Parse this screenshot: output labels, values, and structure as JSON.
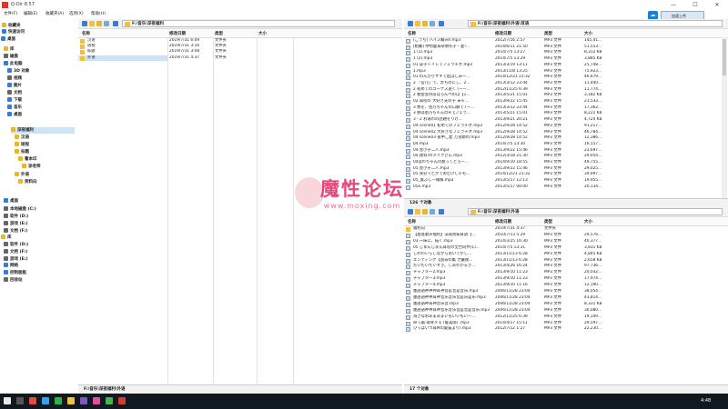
{
  "window": {
    "title": "Q-Dir 8.57",
    "min": "—",
    "max": "☐",
    "close": "✕"
  },
  "menubar": {
    "items": [
      "文件(F)",
      "编辑(E)",
      "收藏夹(A)",
      "选项(X)",
      "帮助(H)"
    ],
    "extra_button": "加速上传"
  },
  "tree": {
    "items": [
      {
        "label": "收藏夹",
        "color": "#e8b730"
      },
      {
        "label": "快速访问",
        "color": "#3a7bd5"
      },
      {
        "label": "桌面",
        "color": "#3a7bd5"
      },
      {
        "label": "库",
        "color": "#e8b730"
      },
      {
        "label": "磁盘",
        "color": "#666666"
      },
      {
        "label": "此电脑",
        "color": "#3a7bd5"
      },
      {
        "label": "3D 对象",
        "color": "#3a7bd5"
      },
      {
        "label": "视频",
        "color": "#666666"
      },
      {
        "label": "图片",
        "color": "#3a7bd5"
      },
      {
        "label": "文档",
        "color": "#666666"
      },
      {
        "label": "下载",
        "color": "#3a7bd5"
      },
      {
        "label": "音乐",
        "color": "#3a7bd5"
      },
      {
        "label": "桌面",
        "color": "#3a7bd5"
      },
      {
        "label": "深夜福利",
        "color": "#e8b730"
      },
      {
        "label": "汉语",
        "color": "#e8b730"
      },
      {
        "label": "短视",
        "color": "#e8b730"
      },
      {
        "label": "标题",
        "color": "#e8b730"
      },
      {
        "label": "看本印",
        "color": "#e8b730"
      },
      {
        "label": "涂老师",
        "color": "#e8b730"
      },
      {
        "label": "外语",
        "color": "#e8b730"
      },
      {
        "label": "资料向",
        "color": "#e8b730"
      },
      {
        "label": "桌面",
        "color": "#3a7bd5"
      },
      {
        "label": "本地磁盘 (C:)",
        "color": "#666666"
      },
      {
        "label": "软件 (D:)",
        "color": "#666666"
      },
      {
        "label": "游戏 (E:)",
        "color": "#666666"
      },
      {
        "label": "文档 (F:)",
        "color": "#666666"
      },
      {
        "label": "库",
        "color": "#e8b730"
      },
      {
        "label": "软件 (D:)",
        "color": "#666666"
      },
      {
        "label": "文档 (F:)",
        "color": "#666666"
      },
      {
        "label": "游戏 (E:)",
        "color": "#666666"
      },
      {
        "label": "网络",
        "color": "#3a7bd5"
      },
      {
        "label": "控制面板",
        "color": "#3a7bd5"
      },
      {
        "label": "回收站",
        "color": "#666666"
      }
    ]
  },
  "columns": {
    "name": "名称",
    "modified": "修改日期",
    "type": "类型",
    "size": "大小"
  },
  "pane1": {
    "path": "F:\\音乐\\深夜福利",
    "rows": [
      {
        "name": "汉语",
        "date": "2019/7/31 6:09",
        "type": "文件夹",
        "size": ""
      },
      {
        "name": "短视",
        "date": "2019/7/31 3:16",
        "type": "文件夹",
        "size": ""
      },
      {
        "name": "标题",
        "date": "2019/7/31 3:08",
        "type": "文件夹",
        "size": ""
      },
      {
        "name": "外语",
        "date": "2019/7/31 4:37",
        "type": "文件夹",
        "size": ""
      }
    ],
    "status": "F:\\音乐\\深夜福利\\外语"
  },
  "pane2": {
    "path": "F:\\音乐\\深夜福利\\外语\\耳语",
    "rows": [
      {
        "name": "[こうち] ハイス概ver.mp3",
        "date": "2012/7/16 2:57",
        "type": "MP3 文件",
        "size": "145,41..."
      },
      {
        "name": "[相聚] 咿哈鹿耳朵侧作子・夏!...",
        "date": "2014/6/11 21:50",
        "type": "MP3 文件",
        "size": "51,553..."
      },
      {
        "name": "1 (1).mp3",
        "date": "2014/7/5 13:27",
        "type": "MP3 文件",
        "size": "8,312 KB"
      },
      {
        "name": "1 (2).mp3",
        "date": "2014/7/5 13:29",
        "type": "MP3 文件",
        "size": "3,885 KB"
      },
      {
        "name": "01 皮子トイレでフェラチオ.mp3",
        "date": "2013/3/19 13:11",
        "type": "MP3 文件",
        "size": "25,748..."
      },
      {
        "name": "1.mp3",
        "date": "2013/11/8 13:25",
        "type": "MP3 文件",
        "size": "75,923..."
      },
      {
        "name": "01.のんびりサキで起ばしみー...",
        "date": "2014/12/21 21:32",
        "type": "MP3 文件",
        "size": "46,679..."
      },
      {
        "name": "2 「宮乃」で、奔ちのにし、2...",
        "date": "2013/3/12 23:44",
        "type": "MP3 文件",
        "size": "11,440..."
      },
      {
        "name": "2 初めてのユーナス遊く (ーー...",
        "date": "2012/11/25 6:39",
        "type": "MP3 文件",
        "size": "11,774..."
      },
      {
        "name": "2 春望窓目前ほろんぺのほ【1...",
        "date": "2013/5/21 15:01",
        "type": "MP3 文件",
        "size": "3,182 KB"
      },
      {
        "name": "02.耳咬の 大好き夫の子 未ゃ...",
        "date": "2013/9/22 15:45",
        "type": "MP3 文件",
        "size": "21,533..."
      },
      {
        "name": "3 悪を、密乃ちゃんの口癖で (ー...",
        "date": "2013/3/12 23:44",
        "type": "MP3 文件",
        "size": "17,362..."
      },
      {
        "name": "3 懸は密乃ちゃんのH【フェラ...",
        "date": "2013/5/21 15:01",
        "type": "MP3 文件",
        "size": "8,222 KB"
      },
      {
        "name": "3 - 2 お湯わの話題をりけ...",
        "date": "2013/9/21 20:21",
        "type": "MP3 文件",
        "size": "4,724 KB"
      },
      {
        "name": "04 scene01 初めてのフェラチオ.mp3",
        "date": "2012/9/28 14:52",
        "type": "MP3 文件",
        "size": "91,217..."
      },
      {
        "name": "04 scene02 大好きなフェラチオ.mp3",
        "date": "2012/9/28 14:52",
        "type": "MP3 文件",
        "size": "46,784..."
      },
      {
        "name": "04 scene03 夜中ご愛 万雪頭目.mp3",
        "date": "2012/9/28 14:52",
        "type": "MP3 文件",
        "size": "12,386..."
      },
      {
        "name": "04.mp3",
        "date": "2014/7/5 13:30",
        "type": "MP3 文件",
        "size": "16,157..."
      },
      {
        "name": "04.金小子二人.mp3",
        "date": "2013/9/22 15:46",
        "type": "MP3 文件",
        "size": "23,697..."
      },
      {
        "name": "04.建ね!のメイクさん.mp3",
        "date": "2012/3/18 21:30",
        "type": "MP3 文件",
        "size": "29,054..."
      },
      {
        "name": "04はわちゃんの疲ってとろー...",
        "date": "2014/9/10 18:55",
        "type": "MP3 文件",
        "size": "49,755..."
      },
      {
        "name": "05.金小子二人.mp3",
        "date": "2013/9/22 15:46",
        "type": "MP3 文件",
        "size": "29,025..."
      },
      {
        "name": "05.身分でどがでおむけしゃも...",
        "date": "2014/12/21 21:32",
        "type": "MP3 文件",
        "size": "34,997..."
      },
      {
        "name": "05_葉ぶしー報媒.mp3",
        "date": "2013/5/17 12:13",
        "type": "MP3 文件",
        "size": "19,955..."
      },
      {
        "name": "05e.mp3",
        "date": "2013/5/17 00:00",
        "type": "MP3 文件",
        "size": "20,134..."
      }
    ],
    "status": "126 个对象"
  },
  "pane3": {
    "path": "F:\\音乐\\深夜福利\\外语",
    "rows": [
      {
        "name": "福利向",
        "date": "2019/7/31 4:37",
        "type": "文件夹",
        "size": "",
        "kind": "folder"
      },
      {
        "name": "【基底歌声福利】法夜而知耳語【...",
        "date": "2010/7/13 5:29",
        "type": "MP3 文件",
        "size": "29,576...",
        "kind": "mp3"
      },
      {
        "name": "03.一味に、描く.mp3",
        "date": "2014/3/25 16:30",
        "type": "MP3 文件",
        "size": "40,377...",
        "kind": "mp3"
      },
      {
        "name": "05 じゅんじゅん耳咬の全合同伴(1)...",
        "date": "2014/7/5 13:31",
        "type": "MP3 文件",
        "size": "3,831 KB",
        "kind": "mp3"
      },
      {
        "name": "しわわいらしながらおいでかし...",
        "date": "2013/11/13 6:28",
        "type": "MP3 文件",
        "size": "4,845 KB",
        "kind": "mp3"
      },
      {
        "name": "エンディング【過去の集 力量後...",
        "date": "2013/11/13 6:28",
        "type": "MP3 文件",
        "size": "2,658 KB",
        "kind": "mp3"
      },
      {
        "name": "だいだいだいすき。しあわかるき...",
        "date": "2013/4/26 16:24",
        "type": "MP3 文件",
        "size": "97,736...",
        "kind": "mp3"
      },
      {
        "name": "チャプター2.mp3",
        "date": "2013/9/10 11:23",
        "type": "MP3 文件",
        "size": "20,032...",
        "kind": "mp3"
      },
      {
        "name": "チャプター3.mp3",
        "date": "2013/9/10 11:23",
        "type": "MP3 文件",
        "size": "17,974...",
        "kind": "mp3"
      },
      {
        "name": "チャプター4.mp3",
        "date": "2013/9/10 11:16",
        "type": "MP3 文件",
        "size": "12,190...",
        "kind": "mp3"
      },
      {
        "name": "墨語語神神神耳神音是音是音乐.mp3",
        "date": "2006/11/28 23:04",
        "type": "MP3 文件",
        "size": "38,054...",
        "kind": "mp3"
      },
      {
        "name": "墨語語神神耳神音乐音乐音是乐是乐.mp3",
        "date": "2006/11/28 23:04",
        "type": "MP3 文件",
        "size": "43,814...",
        "kind": "mp3"
      },
      {
        "name": "墨語語神耳神音乐音.mp3",
        "date": "2006/11/28 23:04",
        "type": "MP3 文件",
        "size": "8,331 KB",
        "kind": "mp3"
      },
      {
        "name": "墨語語神神耳神音乐音乐音是音是音乐.mp3",
        "date": "2006/11/28 23:04",
        "type": "MP3 文件",
        "size": "30,080...",
        "kind": "mp3"
      },
      {
        "name": "海さなおあまあまいもいいもいー...",
        "date": "2012/11/25 6:39",
        "type": "MP3 文件",
        "size": "19,109...",
        "kind": "mp3"
      },
      {
        "name": "命っ嵐-耳骨メモ (鲁美雨) .mp3",
        "date": "2014/4/17 15:11",
        "type": "MP3 文件",
        "size": "29,597...",
        "kind": "mp3"
      },
      {
        "name": "ひっぱいつ耳Mの葉猫より).mp3",
        "date": "2012/7/12 1:27",
        "type": "MP3 文件",
        "size": "22,230...",
        "kind": "mp3"
      }
    ],
    "status": "17 个对象"
  },
  "watermark": {
    "text": "魔性论坛",
    "url": "www.moxing.com"
  },
  "taskbar": {
    "clock": "4:48"
  }
}
